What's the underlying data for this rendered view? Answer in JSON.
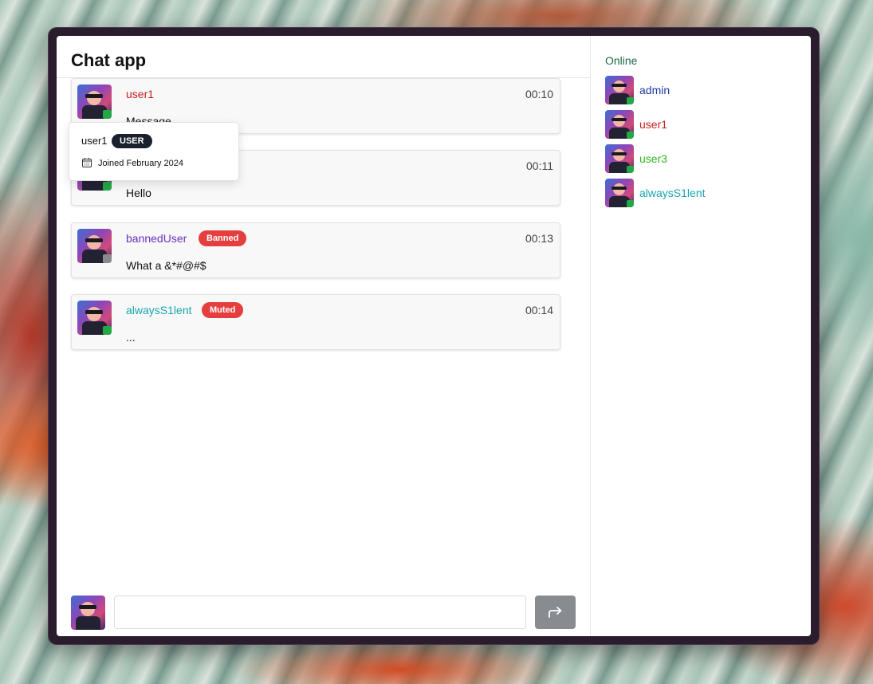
{
  "app": {
    "title": "Chat app"
  },
  "colors": {
    "online": "#22a845",
    "offline": "#8a8a8a",
    "admin": "#1e3aa8",
    "user": "#c81e1e",
    "banned": "#6b2fc4",
    "green_user": "#2fb81e",
    "teal_user": "#17a5b0",
    "badge_red": "#e53e3e"
  },
  "messages": [
    {
      "user": "user1",
      "time": "00:10",
      "text": "Message",
      "badge": ""
    },
    {
      "user": "",
      "time": "00:11",
      "text": "Hello",
      "badge": ""
    },
    {
      "user": "bannedUser",
      "time": "00:13",
      "text": "What a &*#@#$",
      "badge": "Banned"
    },
    {
      "user": "alwaysS1lent",
      "time": "00:14",
      "text": "...",
      "badge": "Muted"
    }
  ],
  "tooltip": {
    "name": "user1",
    "role": "USER",
    "joined": "Joined February 2024"
  },
  "composer": {
    "placeholder": "",
    "send_icon": "forward-arrow-icon"
  },
  "sidebar": {
    "title": "Online",
    "users": [
      {
        "name": "admin"
      },
      {
        "name": "user1"
      },
      {
        "name": "user3"
      },
      {
        "name": "alwaysS1lent"
      }
    ]
  }
}
